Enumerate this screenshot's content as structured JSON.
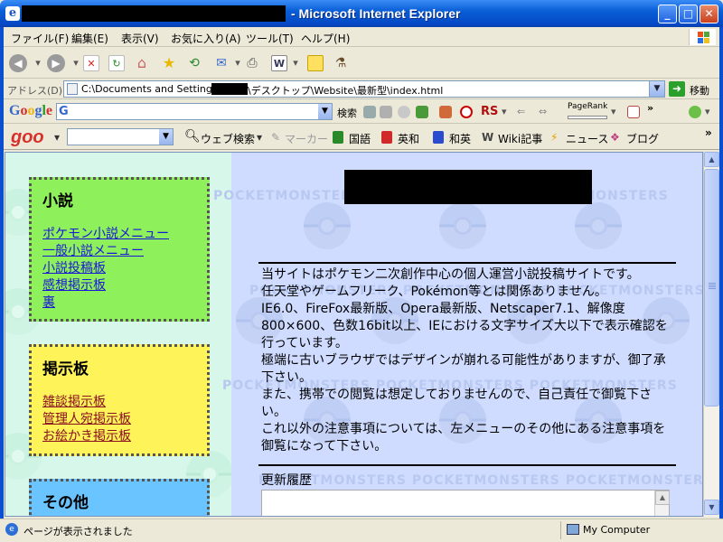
{
  "window": {
    "title": "- Microsoft Internet Explorer",
    "app_icon_glyph": "e"
  },
  "menu": {
    "items": [
      "ファイル(F)",
      "編集(E)",
      "表示(V)",
      "お気に入り(A)",
      "ツール(T)",
      "ヘルプ(H)"
    ]
  },
  "address": {
    "label": "アドレス(D)",
    "url_prefix": "C:\\Documents and Settings\\",
    "url_suffix": "\\デスクトップ\\Website\\最新型\\index.html",
    "go_label": "移動"
  },
  "google_toolbar": {
    "logo": "Google",
    "badge": "G",
    "search_label": "検索",
    "rs_label": "RS",
    "pagerank_label": "PageRank",
    "more": "»"
  },
  "goo_toolbar": {
    "logo": "goo",
    "web_search": "ウェブ検索",
    "marker": "マーカー",
    "kokugo": "国語",
    "eiwa": "英和",
    "waei": "和英",
    "wiki": "Wiki記事",
    "news": "ニュース",
    "blog": "ブログ",
    "more": "»"
  },
  "page": {
    "watermark": "POCKETMONSTERS POCKETMONSTERS POCKETMONSTERS",
    "menus": {
      "novel": {
        "title": "小説",
        "links": [
          "ポケモン小説メニュー",
          "一般小説メニュー",
          "小説投稿板",
          "感想掲示板",
          "裏"
        ]
      },
      "bbs": {
        "title": "掲示板",
        "links": [
          "雑談掲示板",
          "管理人宛掲示板",
          "お絵かき掲示板"
        ]
      },
      "other": {
        "title": "その他"
      }
    },
    "notice": [
      "当サイトはポケモン二次創作中心の個人運営小説投稿サイトです。",
      "任天堂やゲームフリーク、Pokémon等とは関係ありません。",
      "IE6.0、FireFox最新版、Opera最新版、Netscaper7.1、解像度800×600、色数16bit以上、IEにおける文字サイズ大以下で表示確認を行っています。",
      "極端に古いブラウザではデザインが崩れる可能性がありますが、御了承下さい。",
      "また、携帯での閲覧は想定しておりませんので、自己責任で御覧下さい。",
      "これ以外の注意事項については、左メニューのその他にある注意事項を御覧になって下さい。"
    ],
    "history_label": "更新履歴"
  },
  "status": {
    "text": "ページが表示されました",
    "zone": "My Computer"
  }
}
